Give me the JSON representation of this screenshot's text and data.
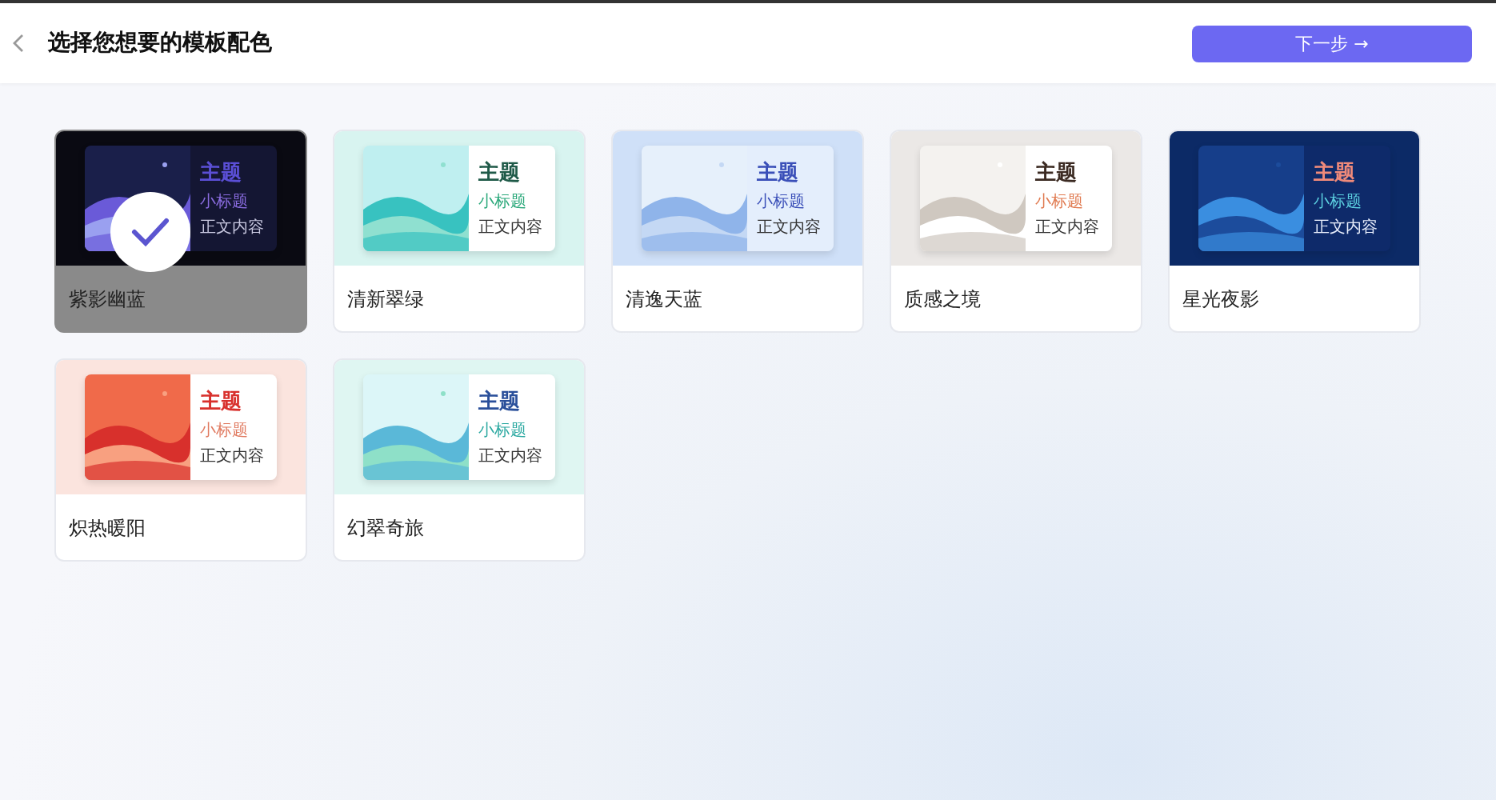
{
  "header": {
    "title": "选择您想要的模板配色",
    "next_button": "下一步 →"
  },
  "themes": [
    {
      "name": "紫影幽蓝",
      "selected": true,
      "color": "#5b4fd6",
      "sample": {
        "title": "主题",
        "subtitle": "小标题",
        "body": "正文内容"
      }
    },
    {
      "name": "清新翠绿",
      "selected": false,
      "color": "#1f5a48",
      "sample": {
        "title": "主题",
        "subtitle": "小标题",
        "body": "正文内容"
      }
    },
    {
      "name": "清逸天蓝",
      "selected": false,
      "color": "#3a4fb8",
      "sample": {
        "title": "主题",
        "subtitle": "小标题",
        "body": "正文内容"
      }
    },
    {
      "name": "质感之境",
      "selected": false,
      "color": "#3b2a22",
      "sample": {
        "title": "主题",
        "subtitle": "小标题",
        "body": "正文内容"
      }
    },
    {
      "name": "星光夜影",
      "selected": false,
      "color": "#f08a7a",
      "sample": {
        "title": "主题",
        "subtitle": "小标题",
        "body": "正文内容"
      }
    },
    {
      "name": "炽热暖阳",
      "selected": false,
      "color": "#d8302c",
      "sample": {
        "title": "主题",
        "subtitle": "小标题",
        "body": "正文内容"
      }
    },
    {
      "name": "幻翠奇旅",
      "selected": false,
      "color": "#2a4f9a",
      "sample": {
        "title": "主题",
        "subtitle": "小标题",
        "body": "正文内容"
      }
    }
  ]
}
